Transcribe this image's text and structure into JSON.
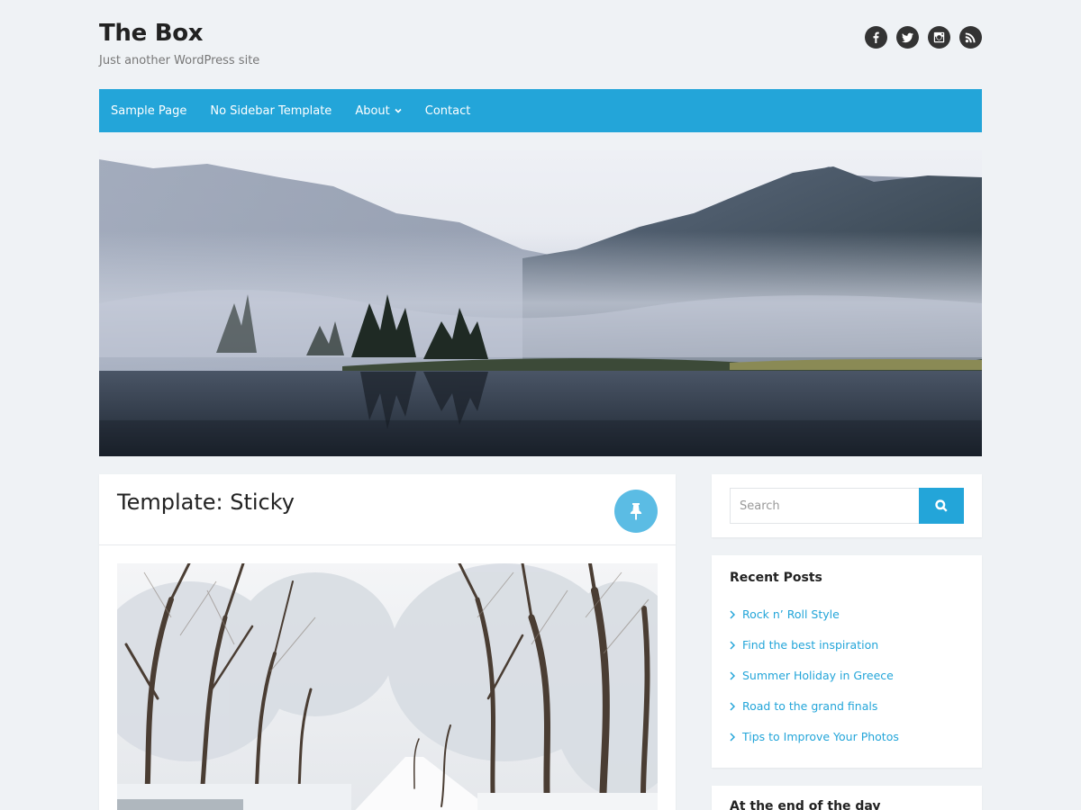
{
  "site": {
    "title": "The Box",
    "description": "Just another WordPress site"
  },
  "social": [
    {
      "name": "facebook",
      "icon": "facebook-icon"
    },
    {
      "name": "twitter",
      "icon": "twitter-icon"
    },
    {
      "name": "instagram",
      "icon": "instagram-icon"
    },
    {
      "name": "rss",
      "icon": "rss-icon"
    }
  ],
  "nav": {
    "items": [
      {
        "label": "Sample Page"
      },
      {
        "label": "No Sidebar Template"
      },
      {
        "label": "About",
        "has_submenu": true
      },
      {
        "label": "Contact"
      }
    ]
  },
  "post": {
    "title": "Template: Sticky",
    "sticky_icon": "pin-icon"
  },
  "sidebar": {
    "search": {
      "placeholder": "Search",
      "button_icon": "search-icon"
    },
    "recent_posts": {
      "title": "Recent Posts",
      "items": [
        "Rock n’ Roll Style",
        "Find the best inspiration",
        "Summer Holiday in Greece",
        "Road to the grand finals",
        "Tips to Improve Your Photos"
      ]
    },
    "next_widget": {
      "title": "At the end of the day"
    }
  },
  "colors": {
    "accent": "#23a5d9",
    "background": "#eff2f5",
    "pin": "#5bbce4"
  }
}
